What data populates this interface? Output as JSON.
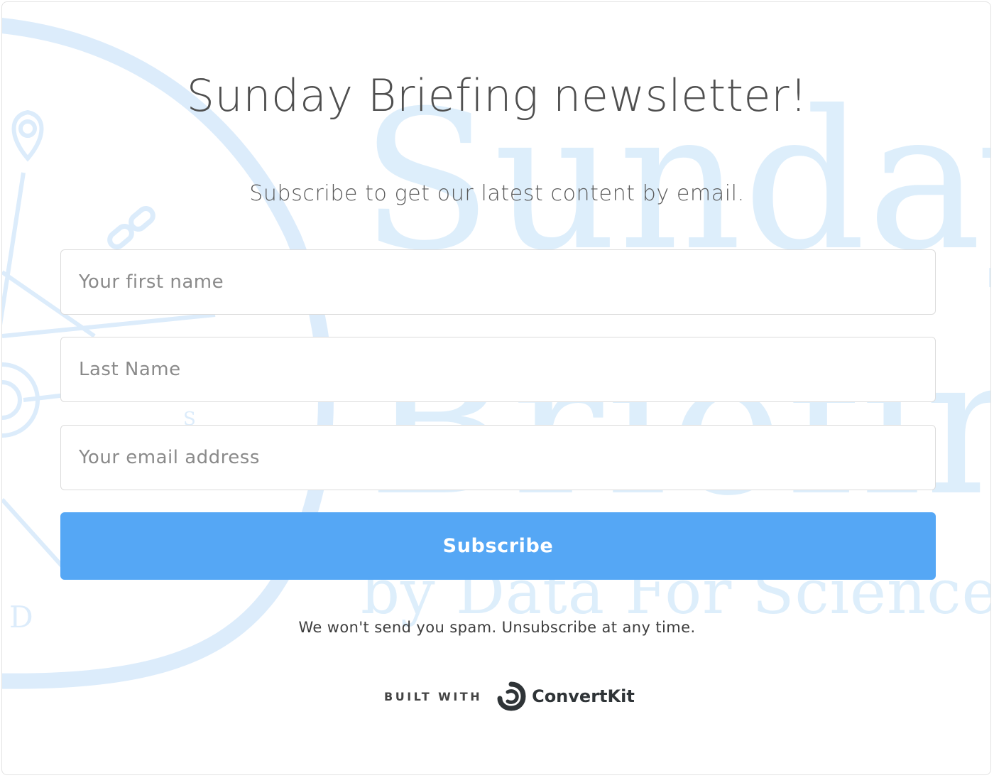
{
  "form": {
    "title": "Sunday Briefing newsletter!",
    "subtitle": "Subscribe to get our latest content by email.",
    "first_name_placeholder": "Your first name",
    "last_name_placeholder": "Last Name",
    "email_placeholder": "Your email address",
    "subscribe_label": "Subscribe",
    "spam_note": "We won't send you spam. Unsubscribe at any time."
  },
  "branding": {
    "built_with_label": "BUILT WITH",
    "provider_name": "ConvertKit",
    "provider_icon": "convertkit-logo-icon"
  },
  "background": {
    "watermark_line1": "Sunday",
    "watermark_line2": "Briefing",
    "watermark_line3": "by Data For Science",
    "accent_color": "#ddeefb"
  },
  "colors": {
    "button": "#55a7f5",
    "button_text": "#ffffff",
    "border": "#dcdcdc"
  }
}
